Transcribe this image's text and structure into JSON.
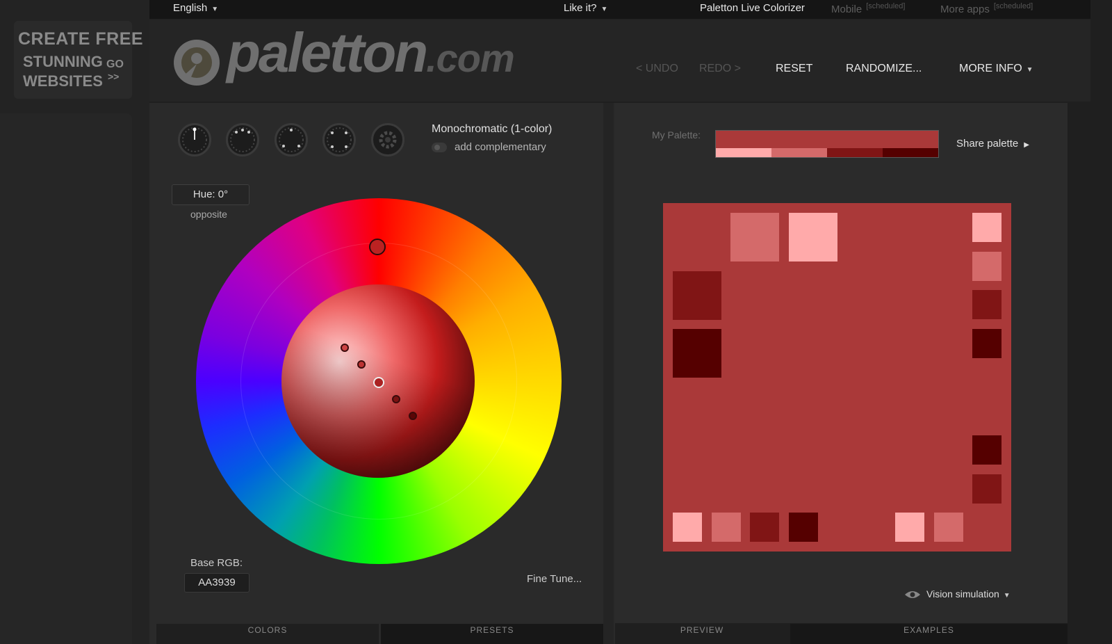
{
  "ad": {
    "line1": "CREATE FREE",
    "line2": "STUNNING",
    "line3": "WEBSITES",
    "go": "GO",
    "arrows": ">>"
  },
  "topbar": {
    "language": "English",
    "like_it": "Like it?",
    "live_colorizer": "Paletton Live Colorizer",
    "mobile": "Mobile",
    "mobile_tag": "[scheduled]",
    "more_apps": "More apps",
    "more_apps_tag": "[scheduled]"
  },
  "header": {
    "logo_main": "paletton",
    "logo_suffix": ".com",
    "undo": "< UNDO",
    "redo": "REDO >",
    "reset": "RESET",
    "randomize": "RANDOMIZE...",
    "more_info": "MORE INFO"
  },
  "scheme": {
    "title": "Monochromatic (1-color)",
    "add_complementary": "add complementary",
    "knobs": [
      "mono-knob-icon",
      "adjacent-knob-icon",
      "triad-knob-icon",
      "tetrad-knob-icon",
      "free-style-knob-icon"
    ]
  },
  "wheel": {
    "hue_label": "Hue: 0°",
    "opposite": "opposite",
    "base_rgb_label": "Base RGB:",
    "base_rgb_value": "AA3939",
    "fine_tune": "Fine Tune..."
  },
  "palette": {
    "label": "My Palette:",
    "share": "Share palette",
    "base": "#AA3939",
    "shades": [
      "#FFAAAA",
      "#D46A6A",
      "#801515",
      "#550000"
    ]
  },
  "colors": {
    "base": "#AA3939",
    "light2": "#FFAAAA",
    "light1": "#D46A6A",
    "dark1": "#801515",
    "dark2": "#550000"
  },
  "tabs": {
    "colors": "COLORS",
    "presets": "PRESETS",
    "preview": "PREVIEW",
    "examples": "EXAMPLES"
  },
  "vision": {
    "label": "Vision simulation"
  }
}
